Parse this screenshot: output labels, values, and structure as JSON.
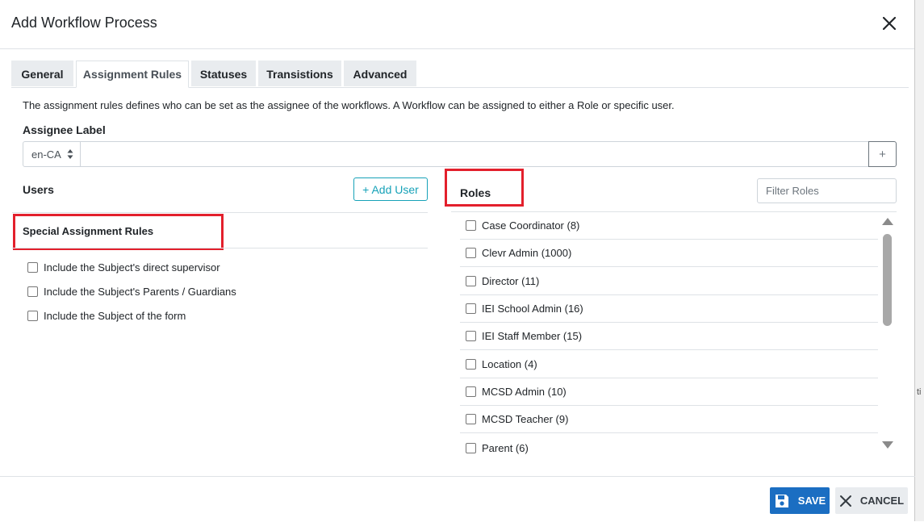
{
  "dialog": {
    "title": "Add Workflow Process"
  },
  "tabs": [
    {
      "label": "General",
      "active": false
    },
    {
      "label": "Assignment Rules",
      "active": true
    },
    {
      "label": "Statuses",
      "active": false
    },
    {
      "label": "Transistions",
      "active": false
    },
    {
      "label": "Advanced",
      "active": false
    }
  ],
  "assignment": {
    "description": "The assignment rules defines who can be set as the assignee of the workflows. A Workflow can be assigned to either a Role or specific user.",
    "assignee_label": "Assignee Label",
    "language": "en-CA",
    "label_value": "",
    "add_label_button": "+"
  },
  "users": {
    "heading": "Users",
    "add_button": "+ Add User"
  },
  "special_rules": {
    "heading": "Special Assignment Rules",
    "items": [
      {
        "label": "Include the Subject's direct supervisor",
        "checked": false
      },
      {
        "label": "Include the Subject's Parents / Guardians",
        "checked": false
      },
      {
        "label": "Include the Subject of the form",
        "checked": false
      }
    ]
  },
  "roles": {
    "heading": "Roles",
    "filter_placeholder": "Filter Roles",
    "items": [
      {
        "label": "Case Coordinator (8)",
        "checked": false
      },
      {
        "label": "Clevr Admin (1000)",
        "checked": false
      },
      {
        "label": "Director (11)",
        "checked": false
      },
      {
        "label": "IEI School Admin (16)",
        "checked": false
      },
      {
        "label": "IEI Staff Member (15)",
        "checked": false
      },
      {
        "label": "Location (4)",
        "checked": false
      },
      {
        "label": "MCSD Admin (10)",
        "checked": false
      },
      {
        "label": "MCSD Teacher (9)",
        "checked": false
      },
      {
        "label": "Parent (6)",
        "checked": false
      }
    ]
  },
  "footer": {
    "save_label": "SAVE",
    "cancel_label": "CANCEL"
  },
  "background_text": "ti",
  "colors": {
    "primary": "#1b6ec2",
    "info": "#17a2b8",
    "highlight": "#e3202c"
  },
  "icons": {
    "close": "close-icon",
    "save": "floppy-disk-icon",
    "cancel": "x-icon",
    "sort": "sort-icon"
  }
}
